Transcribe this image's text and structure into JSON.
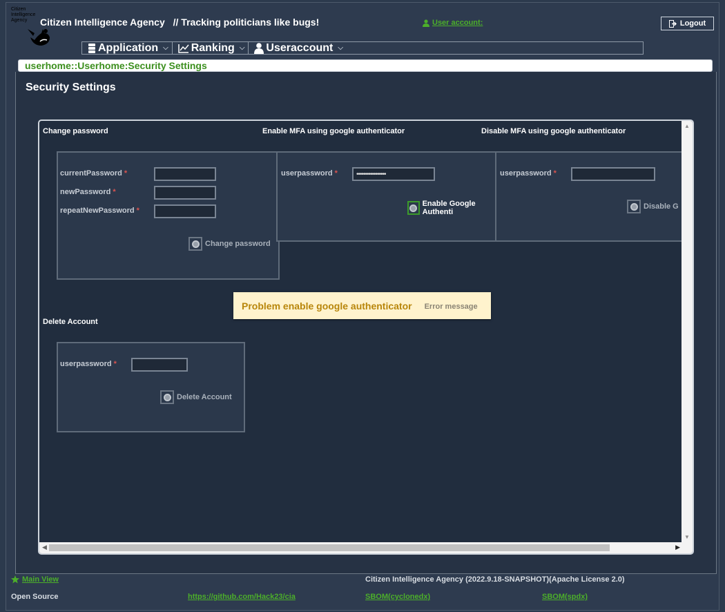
{
  "header": {
    "logo_text": "Citizen\nIntelligence\nAgency",
    "title": "Citizen Intelligence Agency",
    "tagline": "// Tracking politicians like bugs!",
    "user_account": "User account:",
    "logout": "Logout"
  },
  "menu": {
    "items": [
      {
        "label": "Application",
        "icon": "server-icon"
      },
      {
        "label": "Ranking",
        "icon": "line-chart-icon"
      },
      {
        "label": "Useraccount",
        "icon": "user-icon"
      }
    ]
  },
  "breadcrumb": "userhome::Userhome:Security Settings",
  "page_title": "Security Settings",
  "change_password": {
    "title": "Change password",
    "fields": [
      {
        "label": "currentPassword",
        "value": ""
      },
      {
        "label": "newPassword",
        "value": ""
      },
      {
        "label": "repeatNewPassword",
        "value": ""
      }
    ],
    "button": "Change password"
  },
  "enable_mfa": {
    "title": "Enable MFA using google authenticator",
    "field_label": "userpassword",
    "field_value": "•••••••••••••••••",
    "button": "Enable Google Authenti"
  },
  "disable_mfa": {
    "title": "Disable MFA using google authenticator",
    "field_label": "userpassword",
    "field_value": "",
    "button": "Disable G"
  },
  "delete_account": {
    "title": "Delete Account",
    "field_label": "userpassword",
    "field_value": "",
    "button": "Delete Account"
  },
  "notification": {
    "title": "Problem enable google authenticator",
    "message": "Error message"
  },
  "footer": {
    "main_view": "Main View",
    "version": "Citizen Intelligence Agency (2022.9.18-SNAPSHOT)(Apache License 2.0)",
    "open_source": "Open Source",
    "github": "https://github.com/Hack23/cia",
    "sbom_cyclonedx": "SBOM(cyclonedx)",
    "sbom_spdx": "SBOM(spdx)"
  },
  "colors": {
    "accent_green": "#4caf2a",
    "background": "#2c3a4d",
    "notice_bg": "#fff3cd",
    "required": "#d9534f"
  }
}
